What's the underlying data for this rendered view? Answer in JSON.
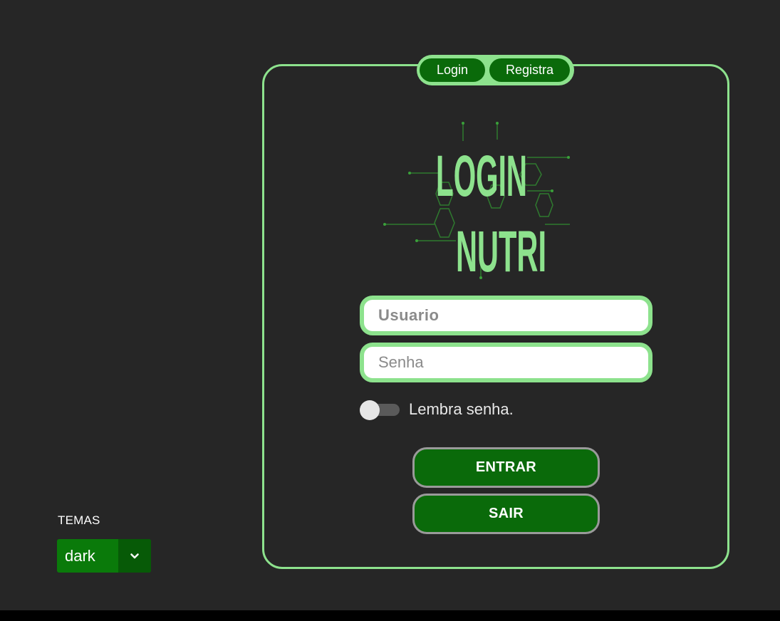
{
  "tabs": {
    "login_label": "Login",
    "registra_label": "Registra"
  },
  "logo": {
    "line1": "LOGIN",
    "line2": "NUTRI"
  },
  "form": {
    "username_placeholder": "Usuario",
    "password_placeholder": "Senha",
    "remember_label": "Lembra senha.",
    "remember_checked": false,
    "submit_label": "ENTRAR",
    "exit_label": "SAIR"
  },
  "theme": {
    "label": "TEMAS",
    "selected": "dark"
  },
  "colors": {
    "background": "#262626",
    "accent_light": "#8de28d",
    "accent_dark": "#0a6a0a",
    "select_green": "#0a7a0a"
  }
}
